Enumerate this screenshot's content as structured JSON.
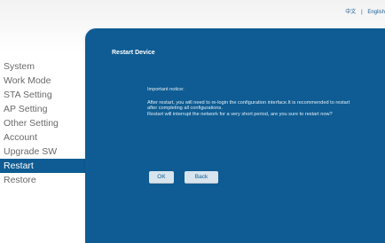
{
  "header": {
    "lang_chinese": "中文",
    "lang_separator": "|",
    "lang_english": "English"
  },
  "sidebar": {
    "items": [
      {
        "label": "System"
      },
      {
        "label": "Work Mode"
      },
      {
        "label": "STA Setting"
      },
      {
        "label": "AP Setting"
      },
      {
        "label": "Other Setting"
      },
      {
        "label": "Account"
      },
      {
        "label": "Upgrade SW"
      },
      {
        "label": "Restart"
      },
      {
        "label": "Restore"
      }
    ],
    "active_index": 7
  },
  "main": {
    "title": "Restart Device",
    "notice_heading": "Important notice:",
    "notice_line1": "After restart, you will need to re-login the configuration interface.It is recommended to restart after completing all configurations.",
    "notice_line2": "Restart will interrupt the network for a very short period, are you sure to restart now?",
    "ok_label": "OK",
    "back_label": "Back"
  },
  "colors": {
    "accent": "#0e5c93",
    "active_nav_bg": "#0e5c93",
    "button_bg": "#d8e4ee",
    "nav_text": "#6a6a6a"
  }
}
